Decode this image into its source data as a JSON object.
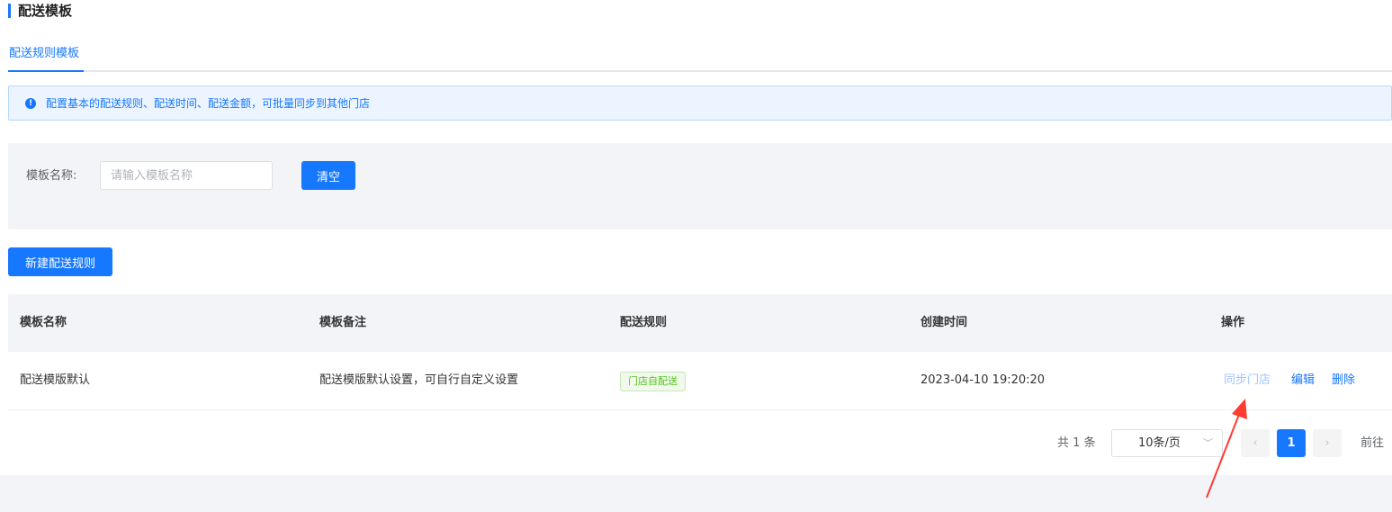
{
  "page": {
    "title": "配送模板"
  },
  "tabs": [
    {
      "label": "配送规则模板"
    }
  ],
  "alert": {
    "text": "配置基本的配送规则、配送时间、配送金额，可批量同步到其他门店",
    "icon": "info-icon"
  },
  "filter": {
    "label": "模板名称:",
    "placeholder": "请输入模板名称",
    "value": "",
    "clear_label": "清空"
  },
  "actions": {
    "new_label": "新建配送规则"
  },
  "table": {
    "columns": [
      "模板名称",
      "模板备注",
      "配送规则",
      "创建时间",
      "操作"
    ],
    "rows": [
      {
        "name": "配送模版默认",
        "remark": "配送模版默认设置，可自行自定义设置",
        "rule": "门店自配送",
        "created": "2023-04-10 19:20:20",
        "ops": {
          "sync": "同步门店",
          "edit": "编辑",
          "delete": "删除"
        }
      }
    ]
  },
  "pagination": {
    "total_text": "共 1 条",
    "page_size": "10条/页",
    "prev_icon": "‹",
    "current": "1",
    "next_icon": "›",
    "goto_label": "前往"
  },
  "colors": {
    "accent": "#1677ff",
    "tag_green": "#52c41a",
    "annotation_arrow": "#ff3b30"
  }
}
